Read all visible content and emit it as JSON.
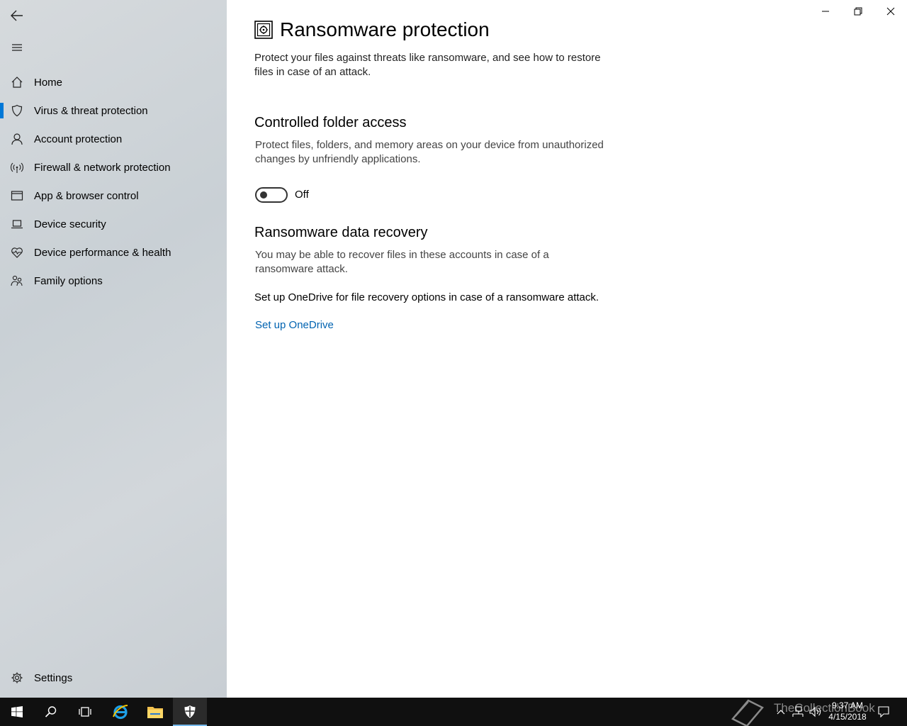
{
  "sidebar": {
    "items": [
      {
        "label": "Home",
        "icon": "home-icon"
      },
      {
        "label": "Virus & threat protection",
        "icon": "shield-icon",
        "active": true
      },
      {
        "label": "Account protection",
        "icon": "person-icon"
      },
      {
        "label": "Firewall & network protection",
        "icon": "wireless-icon"
      },
      {
        "label": "App & browser control",
        "icon": "window-icon"
      },
      {
        "label": "Device security",
        "icon": "laptop-icon"
      },
      {
        "label": "Device performance & health",
        "icon": "heart-pulse-icon"
      },
      {
        "label": "Family options",
        "icon": "family-icon"
      }
    ],
    "settings_label": "Settings"
  },
  "main": {
    "title": "Ransomware protection",
    "intro": "Protect your files against threats like ransomware, and see how to restore files in case of an attack.",
    "cfa": {
      "heading": "Controlled folder access",
      "description": "Protect files, folders, and memory areas on your device from unauthorized changes by unfriendly applications.",
      "toggle_state": "Off"
    },
    "recovery": {
      "heading": "Ransomware data recovery",
      "description": "You may be able to recover files in these accounts in case of a ransomware attack.",
      "onedrive_text": "Set up OneDrive for file recovery options in case of a ransomware attack.",
      "link_label": "Set up OneDrive"
    }
  },
  "taskbar": {
    "time": "9:37 AM",
    "date": "4/15/2018",
    "watermark": "TheCollectionBook"
  },
  "colors": {
    "accent": "#0078d7",
    "link": "#0063b1",
    "taskbar": "#101010"
  }
}
